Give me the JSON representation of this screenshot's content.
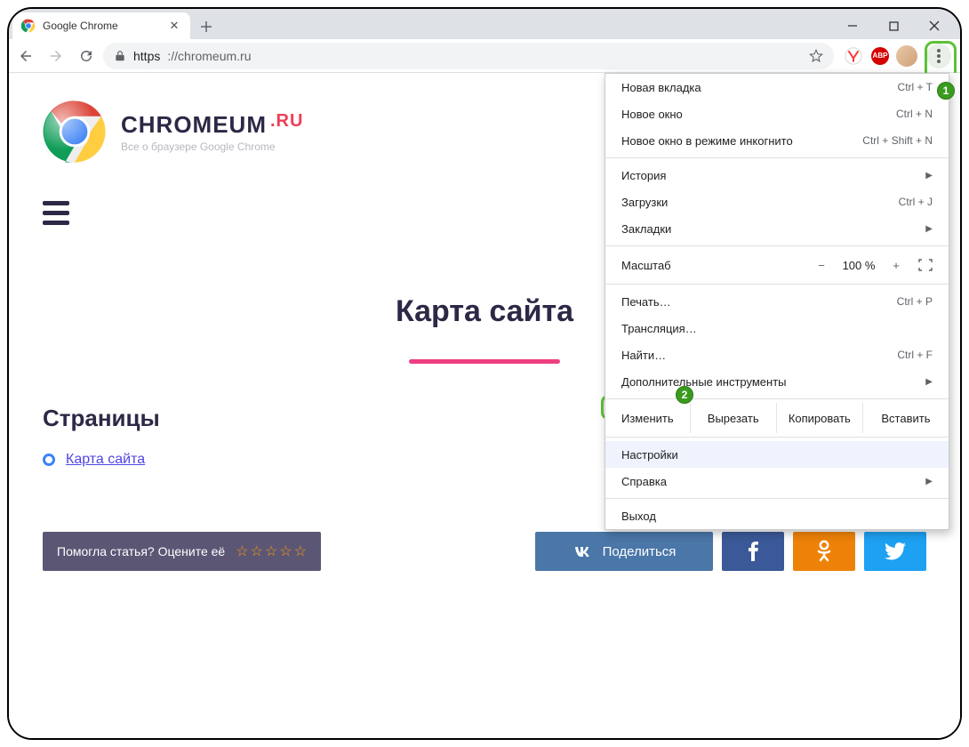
{
  "window": {
    "tab_title": "Google Chrome"
  },
  "toolbar": {
    "url_protocol": "https",
    "url_host": "://chromeum.ru"
  },
  "menu": {
    "new_tab": "Новая вкладка",
    "new_tab_kbd": "Ctrl + T",
    "new_window": "Новое окно",
    "new_window_kbd": "Ctrl + N",
    "incognito": "Новое окно в режиме инкогнито",
    "incognito_kbd": "Ctrl + Shift + N",
    "history": "История",
    "downloads": "Загрузки",
    "downloads_kbd": "Ctrl + J",
    "bookmarks": "Закладки",
    "zoom_label": "Масштаб",
    "zoom_minus": "−",
    "zoom_value": "100 %",
    "zoom_plus": "+",
    "print": "Печать…",
    "print_kbd": "Ctrl + P",
    "cast": "Трансляция…",
    "find": "Найти…",
    "find_kbd": "Ctrl + F",
    "more_tools": "Дополнительные инструменты",
    "edit_label": "Изменить",
    "cut": "Вырезать",
    "copy": "Копировать",
    "paste": "Вставить",
    "settings": "Настройки",
    "help": "Справка",
    "exit": "Выход"
  },
  "page": {
    "brand_name": "CHROMEUM",
    "brand_tld": ".RU",
    "brand_sub": "Все о браузере Google Chrome",
    "title": "Карта сайта",
    "section": "Страницы",
    "link": "Карта сайта",
    "rate_prompt": "Помогла статья? Оцените её",
    "share_vk": "Поделиться"
  },
  "badges": {
    "b1": "1",
    "b2": "2"
  },
  "ext": {
    "abp": "ABP"
  }
}
